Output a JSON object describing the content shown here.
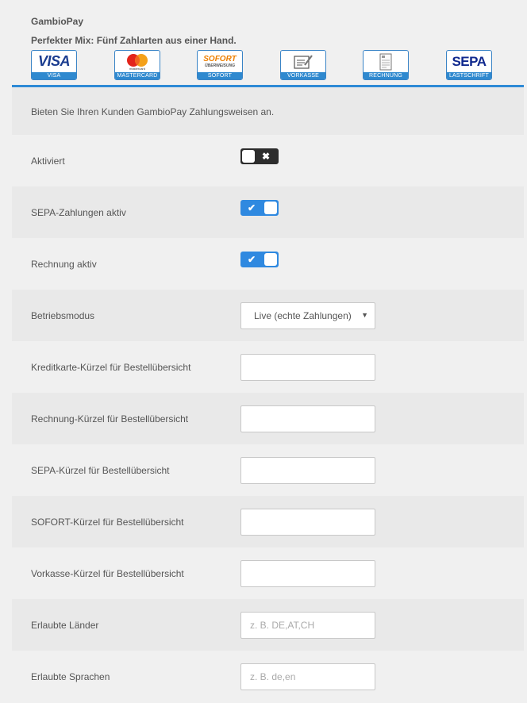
{
  "header": {
    "title": "GambioPay",
    "subtitle": "Perfekter Mix: Fünf Zahlarten aus einer Hand.",
    "logos": [
      {
        "name": "visa",
        "caption": "VISA",
        "text": "VISA"
      },
      {
        "name": "mastercard",
        "caption": "MASTERCARD",
        "text": "mastercard"
      },
      {
        "name": "sofort",
        "caption": "SOFORT",
        "text": "SOFORT",
        "subtext": "ÜBERWEISUNG"
      },
      {
        "name": "vorkasse",
        "caption": "VORKASSE"
      },
      {
        "name": "rechnung",
        "caption": "RECHNUNG"
      },
      {
        "name": "sepa",
        "caption": "LASTSCHRIFT",
        "text": "SEPA"
      }
    ]
  },
  "intro": "Bieten Sie Ihren Kunden GambioPay Zahlungsweisen an.",
  "fields": {
    "aktiviert": {
      "label": "Aktiviert",
      "state": "off",
      "icon": "close-icon"
    },
    "sepa_aktiv": {
      "label": "SEPA-Zahlungen aktiv",
      "state": "on",
      "icon": "checkmark-icon"
    },
    "rechnung_aktiv": {
      "label": "Rechnung aktiv",
      "state": "on",
      "icon": "checkmark-icon"
    },
    "betriebsmodus": {
      "label": "Betriebsmodus",
      "value": "Live (echte Zahlungen)"
    },
    "kreditkarte_kuerzel": {
      "label": "Kreditkarte-Kürzel für Bestellübersicht",
      "value": "",
      "placeholder": ""
    },
    "rechnung_kuerzel": {
      "label": "Rechnung-Kürzel für Bestellübersicht",
      "value": "",
      "placeholder": ""
    },
    "sepa_kuerzel": {
      "label": "SEPA-Kürzel für Bestellübersicht",
      "value": "",
      "placeholder": ""
    },
    "sofort_kuerzel": {
      "label": "SOFORT-Kürzel für Bestellübersicht",
      "value": "",
      "placeholder": ""
    },
    "vorkasse_kuerzel": {
      "label": "Vorkasse-Kürzel für Bestellübersicht",
      "value": "",
      "placeholder": ""
    },
    "laender": {
      "label": "Erlaubte Länder",
      "value": "",
      "placeholder": "z. B. DE,AT,CH"
    },
    "sprachen": {
      "label": "Erlaubte Sprachen",
      "value": "",
      "placeholder": "z. B. de,en"
    }
  },
  "colors": {
    "accent": "#2e8ad6",
    "toggle_off": "#2d2d2d",
    "toggle_on": "#2f89e0",
    "row_shade": "#e9e9e9",
    "background": "#f0f0f0"
  }
}
